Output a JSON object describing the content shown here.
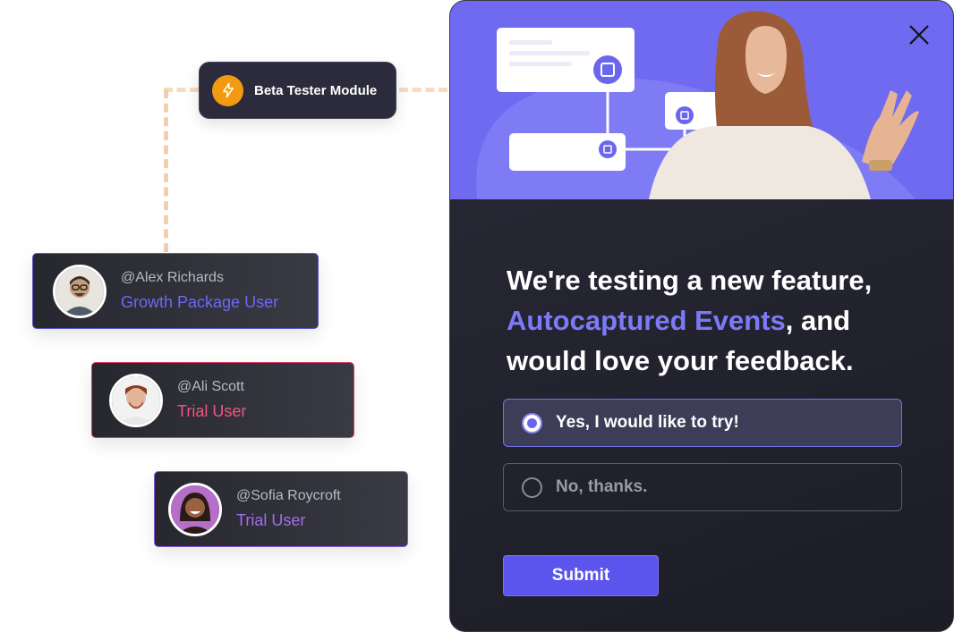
{
  "module": {
    "label": "Beta Tester Module",
    "icon": "lightning-bolt-icon",
    "icon_color": "#f29a12"
  },
  "users": [
    {
      "handle": "@Alex Richards",
      "role": "Growth Package User",
      "role_color": "#6d69f5",
      "border_color": "#5b58c8"
    },
    {
      "handle": "@Ali Scott",
      "role": "Trial User",
      "role_color": "#f2557f",
      "border_color": "#d6406a"
    },
    {
      "handle": "@Sofia Roycroft",
      "role": "Trial User",
      "role_color": "#a36cf0",
      "border_color": "#8a55d8"
    }
  ],
  "popup": {
    "close_icon": "close-icon",
    "headline_part1": "We're testing a new feature,",
    "headline_highlight": "Autocaptured Events",
    "headline_part2": ", and would love your feedback.",
    "options": [
      {
        "label": "Yes, I would like to try!",
        "selected": true
      },
      {
        "label": "No, thanks.",
        "selected": false
      }
    ],
    "submit_label": "Submit",
    "accent_color": "#5b55ee"
  }
}
